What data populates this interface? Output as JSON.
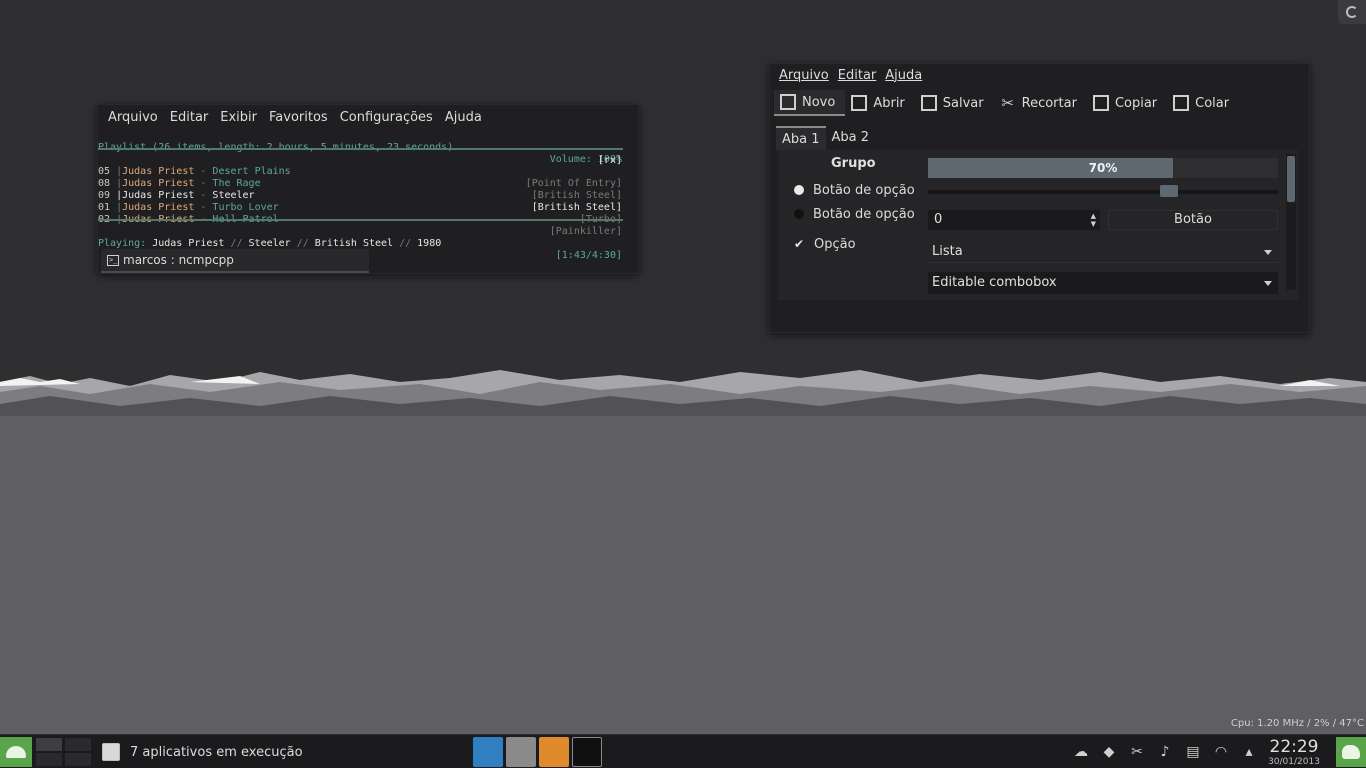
{
  "terminal": {
    "menu": [
      "Arquivo",
      "Editar",
      "Exibir",
      "Favoritos",
      "Configurações",
      "Ajuda"
    ],
    "playlist_info": "Playlist (26 items, length: 2 hours, 5 minutes, 23 seconds)",
    "volume": "Volume: 100%",
    "mode_flags": "[rx]",
    "tracks": [
      {
        "num": "05",
        "artist": "Judas Priest",
        "sep": " - ",
        "title": "Desert Plains",
        "album": "[Point Of Entry]"
      },
      {
        "num": "08",
        "artist": "Judas Priest",
        "sep": " - ",
        "title": "The Rage",
        "album": "[British Steel]"
      },
      {
        "num": "09",
        "artist": "Judas Priest",
        "sep": " - ",
        "title": "Steeler",
        "album": "[British Steel]"
      },
      {
        "num": "01",
        "artist": "Judas Priest",
        "sep": " - ",
        "title": "Turbo Lover",
        "album": "[Turbo]"
      },
      {
        "num": "02",
        "artist": "Judas Priest",
        "sep": " - ",
        "title": "Hell Patrol",
        "album": "[Painkiller]"
      }
    ],
    "now_playing": {
      "prefix": "Playing: ",
      "artist": "Judas Priest",
      "title": "Steeler",
      "album": "British Steel",
      "year": "1980",
      "divider": " // ",
      "time": "[1:43/4:30]"
    },
    "tab_title": "marcos : ncmpcpp"
  },
  "widgets": {
    "menu": [
      "Arquivo",
      "Editar",
      "Ajuda"
    ],
    "toolbar": [
      {
        "label": "Novo",
        "icon": "new-document-icon"
      },
      {
        "label": "Abrir",
        "icon": "open-folder-icon"
      },
      {
        "label": "Salvar",
        "icon": "save-icon"
      },
      {
        "label": "Recortar",
        "icon": "scissors-icon"
      },
      {
        "label": "Copiar",
        "icon": "copy-icon"
      },
      {
        "label": "Colar",
        "icon": "paste-icon"
      }
    ],
    "tabs": [
      "Aba 1",
      "Aba 2"
    ],
    "group_title": "Grupo",
    "radio_1": "Botão de opção",
    "radio_2": "Botão de opção",
    "checkbox": "Opção",
    "progress": {
      "value": 70,
      "label": "70%"
    },
    "slider": {
      "value": 0.7
    },
    "spinbox_value": "0",
    "button": "Botão",
    "combo_list": "Lista",
    "combo_editable": "Editable combobox"
  },
  "panel": {
    "cpu": "Cpu: 1.20 MHz / 2% / 47°C",
    "tasks_label": "7 aplicativos em execução",
    "time": "22:29",
    "date": "30/01/2013"
  },
  "colors": {
    "accent_green": "#5aa54a",
    "terminal_cyan": "#5fa898",
    "terminal_orange": "#e0a77a",
    "progress_fill": "#5e6870"
  }
}
